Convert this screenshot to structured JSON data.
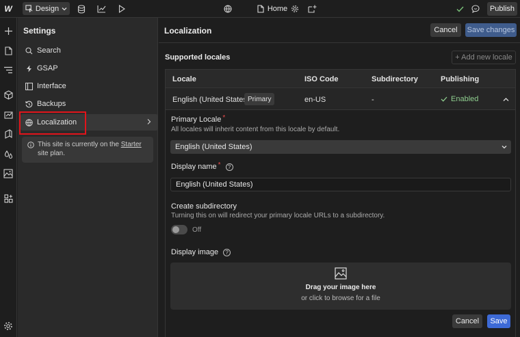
{
  "topbar": {
    "logo": "W",
    "mode_label": "Design",
    "page_name": "Home",
    "publish_label": "Publish",
    "icons": [
      "database-icon",
      "chart-icon",
      "play-icon",
      "globe-icon",
      "page-icon",
      "gear-icon",
      "add-page-icon",
      "check-icon",
      "comment-icon"
    ]
  },
  "rail": {
    "icons": [
      "plus-icon",
      "page-icon",
      "navigator-icon",
      "cube-icon",
      "cms-icon",
      "assets-icon",
      "styles-icon",
      "image-icon",
      "apps-icon",
      "settings-icon"
    ]
  },
  "settings": {
    "title": "Settings",
    "items": [
      {
        "label": "Search",
        "icon": "search-icon"
      },
      {
        "label": "GSAP",
        "icon": "bolt-icon"
      },
      {
        "label": "Interface",
        "icon": "layout-icon"
      },
      {
        "label": "Backups",
        "icon": "history-icon"
      },
      {
        "label": "Localization",
        "icon": "globe-icon"
      }
    ],
    "notice_text": "This site is currently on the ",
    "notice_link": "Starter",
    "notice_suffix": "site plan."
  },
  "main": {
    "title": "Localization",
    "cancel_label": "Cancel",
    "save_changes_label": "Save changes",
    "section_title": "Supported locales",
    "add_locale_label": "+ Add new locale",
    "columns": [
      "Locale",
      "ISO Code",
      "Subdirectory",
      "Publishing"
    ],
    "row": {
      "locale": "English (United States)",
      "badge": "Primary",
      "iso": "en-US",
      "subdirectory": "-",
      "publishing": "Enabled"
    },
    "primary_locale": {
      "label": "Primary Locale",
      "required": "*",
      "hint": "All locales will inherit content from this locale by default.",
      "value": "English (United States)"
    },
    "display_name": {
      "label": "Display name",
      "required": "*",
      "value": "English (United States)"
    },
    "subdirectory": {
      "label": "Create subdirectory",
      "hint": "Turning this on will redirect your primary locale URLs to a subdirectory.",
      "toggle_label": "Off",
      "enabled": false
    },
    "display_image": {
      "label": "Display image",
      "drop_title": "Drag your image here",
      "drop_sub": "or click to browse for a file"
    },
    "form_cancel_label": "Cancel",
    "form_save_label": "Save"
  },
  "colors": {
    "accent_blue": "#3d6ad6",
    "enabled_green": "#8fce8f",
    "required_red": "#ea4b4b",
    "highlight_red": "#e2141b"
  }
}
